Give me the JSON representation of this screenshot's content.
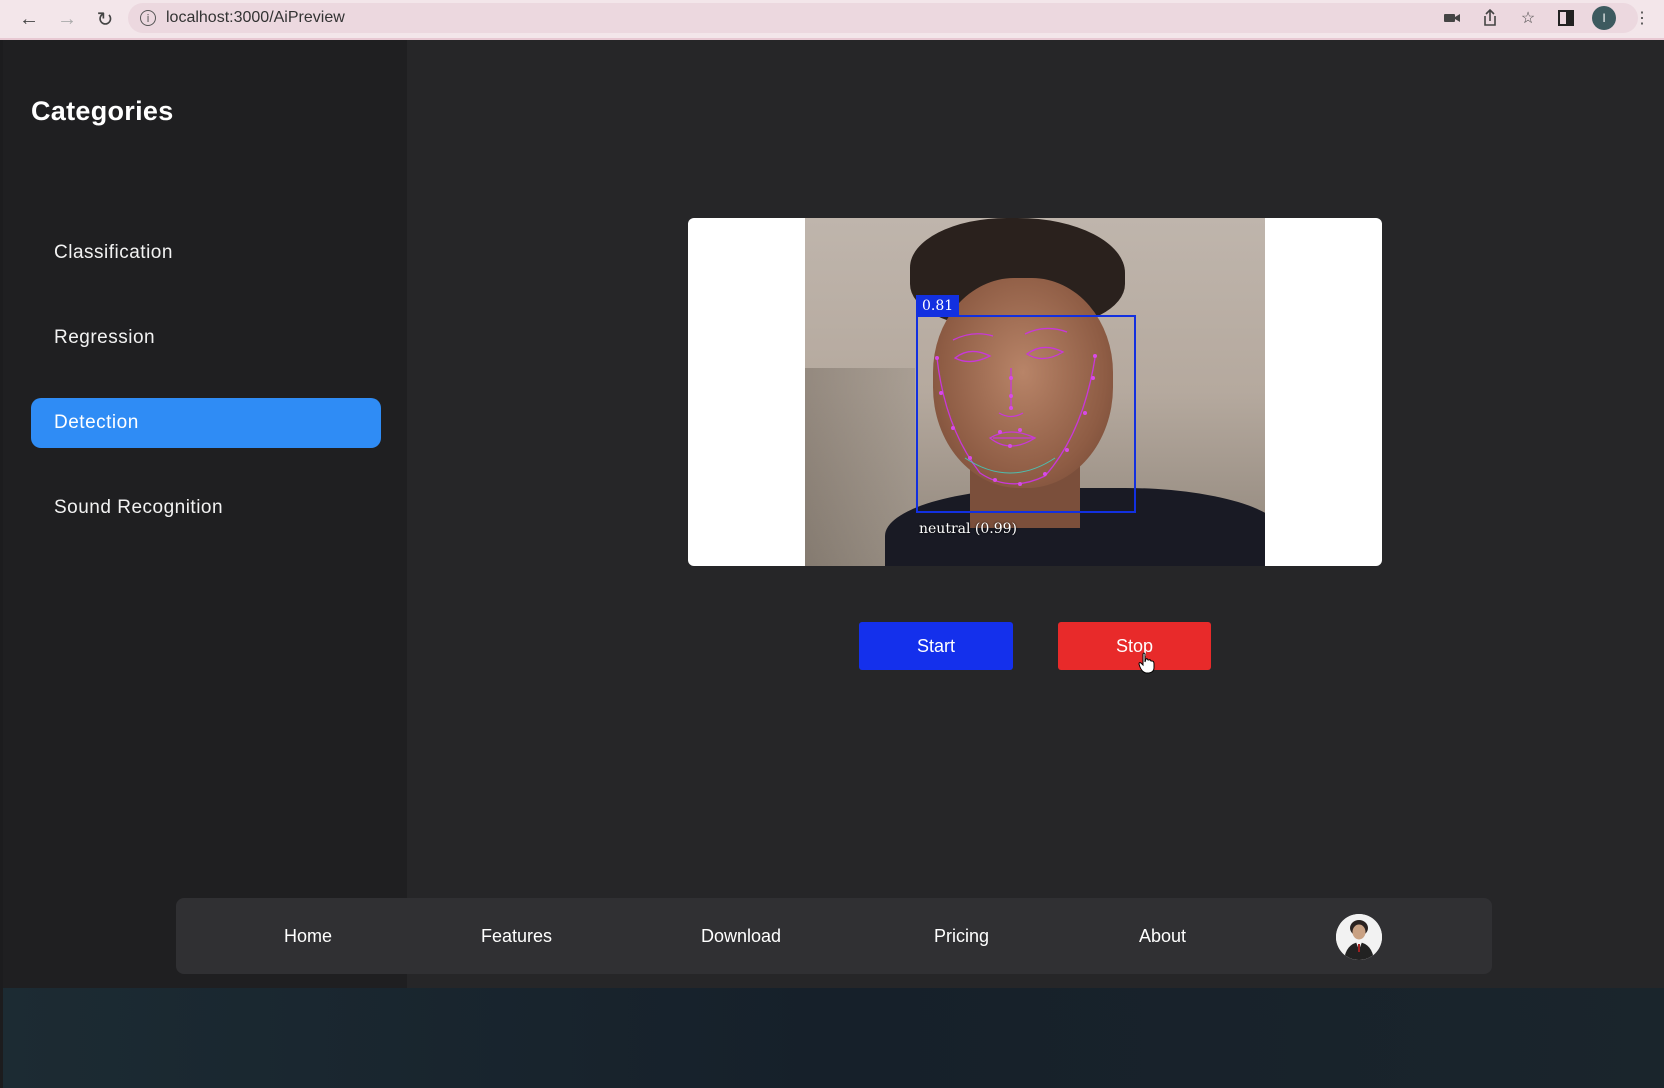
{
  "browser": {
    "url": "localhost:3000/AiPreview",
    "profile_initial": "I"
  },
  "sidebar": {
    "title": "Categories",
    "items": [
      {
        "label": "Classification",
        "active": false
      },
      {
        "label": "Regression",
        "active": false
      },
      {
        "label": "Detection",
        "active": true
      },
      {
        "label": "Sound Recognition",
        "active": false
      }
    ]
  },
  "detection": {
    "score": "0.81",
    "expression": "neutral (0.99)"
  },
  "controls": {
    "start_label": "Start",
    "stop_label": "Stop"
  },
  "nav": {
    "items": [
      "Home",
      "Features",
      "Download",
      "Pricing",
      "About"
    ]
  },
  "colors": {
    "active_item": "#2f8cf5",
    "start": "#1430ec",
    "stop": "#e82a2a",
    "detection_box": "#1230e0",
    "landmarks": "#c838d8"
  }
}
